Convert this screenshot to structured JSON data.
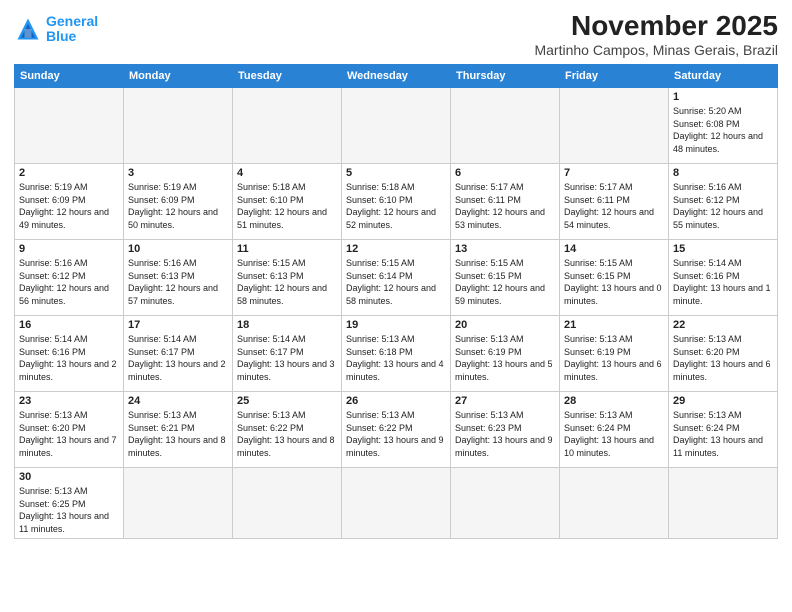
{
  "logo": {
    "line1": "General",
    "line2": "Blue"
  },
  "title": "November 2025",
  "location": "Martinho Campos, Minas Gerais, Brazil",
  "days_of_week": [
    "Sunday",
    "Monday",
    "Tuesday",
    "Wednesday",
    "Thursday",
    "Friday",
    "Saturday"
  ],
  "weeks": [
    [
      {
        "num": "",
        "info": ""
      },
      {
        "num": "",
        "info": ""
      },
      {
        "num": "",
        "info": ""
      },
      {
        "num": "",
        "info": ""
      },
      {
        "num": "",
        "info": ""
      },
      {
        "num": "",
        "info": ""
      },
      {
        "num": "1",
        "info": "Sunrise: 5:20 AM\nSunset: 6:08 PM\nDaylight: 12 hours and 48 minutes."
      }
    ],
    [
      {
        "num": "2",
        "info": "Sunrise: 5:19 AM\nSunset: 6:09 PM\nDaylight: 12 hours and 49 minutes."
      },
      {
        "num": "3",
        "info": "Sunrise: 5:19 AM\nSunset: 6:09 PM\nDaylight: 12 hours and 50 minutes."
      },
      {
        "num": "4",
        "info": "Sunrise: 5:18 AM\nSunset: 6:10 PM\nDaylight: 12 hours and 51 minutes."
      },
      {
        "num": "5",
        "info": "Sunrise: 5:18 AM\nSunset: 6:10 PM\nDaylight: 12 hours and 52 minutes."
      },
      {
        "num": "6",
        "info": "Sunrise: 5:17 AM\nSunset: 6:11 PM\nDaylight: 12 hours and 53 minutes."
      },
      {
        "num": "7",
        "info": "Sunrise: 5:17 AM\nSunset: 6:11 PM\nDaylight: 12 hours and 54 minutes."
      },
      {
        "num": "8",
        "info": "Sunrise: 5:16 AM\nSunset: 6:12 PM\nDaylight: 12 hours and 55 minutes."
      }
    ],
    [
      {
        "num": "9",
        "info": "Sunrise: 5:16 AM\nSunset: 6:12 PM\nDaylight: 12 hours and 56 minutes."
      },
      {
        "num": "10",
        "info": "Sunrise: 5:16 AM\nSunset: 6:13 PM\nDaylight: 12 hours and 57 minutes."
      },
      {
        "num": "11",
        "info": "Sunrise: 5:15 AM\nSunset: 6:13 PM\nDaylight: 12 hours and 58 minutes."
      },
      {
        "num": "12",
        "info": "Sunrise: 5:15 AM\nSunset: 6:14 PM\nDaylight: 12 hours and 58 minutes."
      },
      {
        "num": "13",
        "info": "Sunrise: 5:15 AM\nSunset: 6:15 PM\nDaylight: 12 hours and 59 minutes."
      },
      {
        "num": "14",
        "info": "Sunrise: 5:15 AM\nSunset: 6:15 PM\nDaylight: 13 hours and 0 minutes."
      },
      {
        "num": "15",
        "info": "Sunrise: 5:14 AM\nSunset: 6:16 PM\nDaylight: 13 hours and 1 minute."
      }
    ],
    [
      {
        "num": "16",
        "info": "Sunrise: 5:14 AM\nSunset: 6:16 PM\nDaylight: 13 hours and 2 minutes."
      },
      {
        "num": "17",
        "info": "Sunrise: 5:14 AM\nSunset: 6:17 PM\nDaylight: 13 hours and 2 minutes."
      },
      {
        "num": "18",
        "info": "Sunrise: 5:14 AM\nSunset: 6:17 PM\nDaylight: 13 hours and 3 minutes."
      },
      {
        "num": "19",
        "info": "Sunrise: 5:13 AM\nSunset: 6:18 PM\nDaylight: 13 hours and 4 minutes."
      },
      {
        "num": "20",
        "info": "Sunrise: 5:13 AM\nSunset: 6:19 PM\nDaylight: 13 hours and 5 minutes."
      },
      {
        "num": "21",
        "info": "Sunrise: 5:13 AM\nSunset: 6:19 PM\nDaylight: 13 hours and 6 minutes."
      },
      {
        "num": "22",
        "info": "Sunrise: 5:13 AM\nSunset: 6:20 PM\nDaylight: 13 hours and 6 minutes."
      }
    ],
    [
      {
        "num": "23",
        "info": "Sunrise: 5:13 AM\nSunset: 6:20 PM\nDaylight: 13 hours and 7 minutes."
      },
      {
        "num": "24",
        "info": "Sunrise: 5:13 AM\nSunset: 6:21 PM\nDaylight: 13 hours and 8 minutes."
      },
      {
        "num": "25",
        "info": "Sunrise: 5:13 AM\nSunset: 6:22 PM\nDaylight: 13 hours and 8 minutes."
      },
      {
        "num": "26",
        "info": "Sunrise: 5:13 AM\nSunset: 6:22 PM\nDaylight: 13 hours and 9 minutes."
      },
      {
        "num": "27",
        "info": "Sunrise: 5:13 AM\nSunset: 6:23 PM\nDaylight: 13 hours and 9 minutes."
      },
      {
        "num": "28",
        "info": "Sunrise: 5:13 AM\nSunset: 6:24 PM\nDaylight: 13 hours and 10 minutes."
      },
      {
        "num": "29",
        "info": "Sunrise: 5:13 AM\nSunset: 6:24 PM\nDaylight: 13 hours and 11 minutes."
      }
    ],
    [
      {
        "num": "30",
        "info": "Sunrise: 5:13 AM\nSunset: 6:25 PM\nDaylight: 13 hours and 11 minutes."
      },
      {
        "num": "",
        "info": ""
      },
      {
        "num": "",
        "info": ""
      },
      {
        "num": "",
        "info": ""
      },
      {
        "num": "",
        "info": ""
      },
      {
        "num": "",
        "info": ""
      },
      {
        "num": "",
        "info": ""
      }
    ]
  ]
}
